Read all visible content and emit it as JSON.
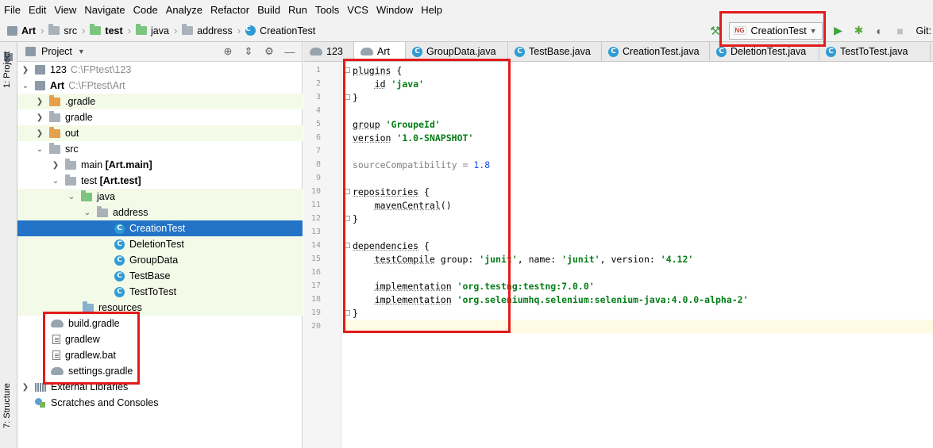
{
  "menu": [
    "File",
    "Edit",
    "View",
    "Navigate",
    "Code",
    "Analyze",
    "Refactor",
    "Build",
    "Run",
    "Tools",
    "VCS",
    "Window",
    "Help"
  ],
  "breadcrumb": [
    "Art",
    "src",
    "test",
    "java",
    "address",
    "CreationTest"
  ],
  "run_config": {
    "label": "CreationTest",
    "badge": "NG"
  },
  "git_label": "Git:",
  "stripe": {
    "project_tab": "1: Project",
    "structure_tab": "7: Structure"
  },
  "project_panel": {
    "title": "Project",
    "tree": [
      {
        "label": "123",
        "path": "C:\\FPtest\\123",
        "bold": false
      },
      {
        "label": "Art",
        "path": "C:\\FPtest\\Art",
        "bold": true
      },
      {
        "label": ".gradle"
      },
      {
        "label": "gradle"
      },
      {
        "label": "out"
      },
      {
        "label": "src"
      },
      {
        "label": "main",
        "suffix": "[Art.main]"
      },
      {
        "label": "test",
        "suffix": "[Art.test]"
      },
      {
        "label": "java"
      },
      {
        "label": "address"
      },
      {
        "label": "CreationTest"
      },
      {
        "label": "DeletionTest"
      },
      {
        "label": "GroupData"
      },
      {
        "label": "TestBase"
      },
      {
        "label": "TestToTest"
      },
      {
        "label": "resources"
      },
      {
        "label": "build.gradle"
      },
      {
        "label": "gradlew"
      },
      {
        "label": "gradlew.bat"
      },
      {
        "label": "settings.gradle"
      },
      {
        "label": "External Libraries"
      },
      {
        "label": "Scratches and Consoles"
      }
    ]
  },
  "tabs": [
    "123",
    "Art",
    "GroupData.java",
    "TestBase.java",
    "CreationTest.java",
    "DeletionTest.java",
    "TestToTest.java"
  ],
  "editor": {
    "line_numbers": [
      "1",
      "2",
      "3",
      "4",
      "5",
      "6",
      "7",
      "8",
      "9",
      "10",
      "11",
      "12",
      "13",
      "14",
      "15",
      "16",
      "17",
      "18",
      "19",
      "20"
    ],
    "code": {
      "l1_kw": "plugins",
      "l1_rest": " {",
      "l2_kw": "id",
      "l2_str": "'java'",
      "l3": "}",
      "l5_kw": "group",
      "l5_str": "'GroupeId'",
      "l6_kw": "version",
      "l6_str": "'1.0-SNAPSHOT'",
      "l8_kw": "sourceCompatibility",
      "l8_eq": " = ",
      "l8_num": "1.8",
      "l10_kw": "repositories",
      "l10_rest": " {",
      "l11_kw": "mavenCentral",
      "l11_rest": "()",
      "l12": "}",
      "l14_kw": "dependencies",
      "l14_rest": " {",
      "l15_kw": "testCompile",
      "l15_a": " group: ",
      "l15_s1": "'junit'",
      "l15_b": ", name: ",
      "l15_s2": "'junit'",
      "l15_c": ", version: ",
      "l15_s3": "'4.12'",
      "l17_kw": "implementation",
      "l17_str": "'org.testng:testng:7.0.0'",
      "l18_kw": "implementation",
      "l18_str": "'org.seleniumhq.selenium:selenium-java:4.0.0-alpha-2'",
      "l19": "}"
    }
  },
  "colors": {
    "highlight_box": "#e31b1b",
    "selection": "#2374c6",
    "string": "#067d17",
    "number": "#1750eb"
  }
}
